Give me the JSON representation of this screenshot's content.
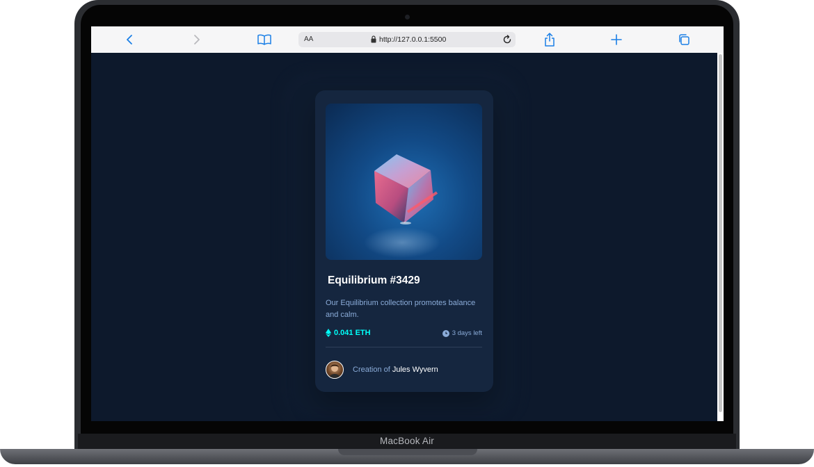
{
  "device": {
    "model_label": "MacBook Air"
  },
  "browser": {
    "text_size_label": "AA",
    "url": "http://127.0.0.1:5500",
    "icons": [
      "back-icon",
      "forward-icon",
      "bookmarks-icon",
      "lock-icon",
      "reload-icon",
      "share-icon",
      "new-tab-icon",
      "tabs-icon"
    ]
  },
  "card": {
    "title": "Equilibrium #3429",
    "description": "Our Equilibrium collection promotes balance and calm.",
    "price": "0.041 ETH",
    "time_left": "3 days left",
    "creator_prefix": "Creation of",
    "creator_name": "Jules Wyvern"
  },
  "colors": {
    "page_bg": "#0d192c",
    "card_bg": "#15263f",
    "accent_cyan": "#00fff8",
    "soft_blue": "#8bacd9",
    "browser_blue": "#1a7fe6"
  }
}
